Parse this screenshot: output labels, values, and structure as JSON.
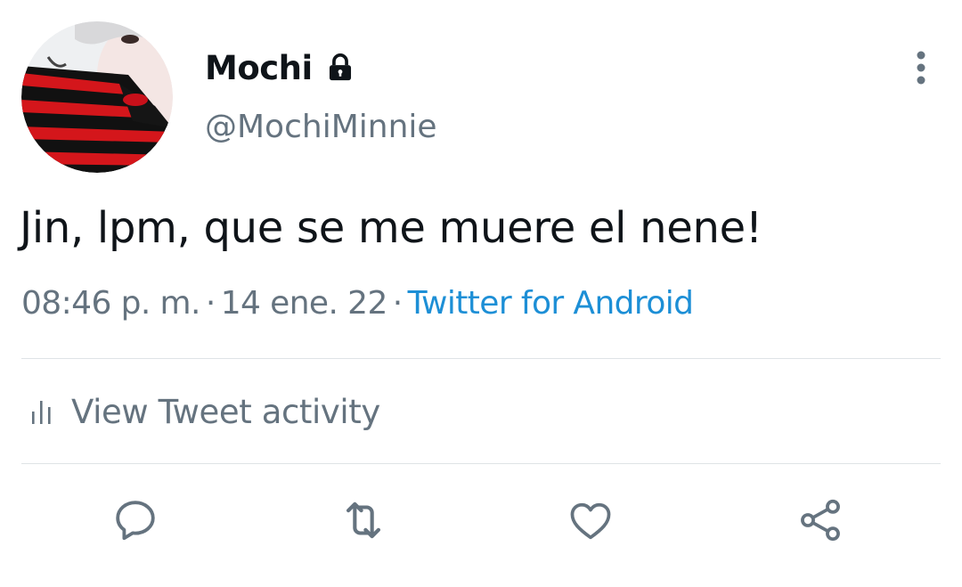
{
  "user": {
    "display_name": "Mochi",
    "handle": "@MochiMinnie",
    "protected_icon": "lock-icon",
    "avatar_icon": "profile-photo"
  },
  "tweet": {
    "text": "Jin, lpm, que se me muere el nene!",
    "time": "08:46 p. m.",
    "separator": "·",
    "date": "14 ene. 22",
    "source": "Twitter for Android"
  },
  "activity": {
    "label": "View Tweet activity",
    "icon": "bar-chart-icon"
  },
  "actions": [
    {
      "name": "reply",
      "icon": "comment-icon"
    },
    {
      "name": "retweet",
      "icon": "retweet-icon"
    },
    {
      "name": "like",
      "icon": "heart-icon"
    },
    {
      "name": "share",
      "icon": "share-icon"
    }
  ],
  "colors": {
    "text": "#0f1419",
    "secondary": "#65737f",
    "link": "#1d8fd6",
    "divider": "#dfe3e6"
  }
}
